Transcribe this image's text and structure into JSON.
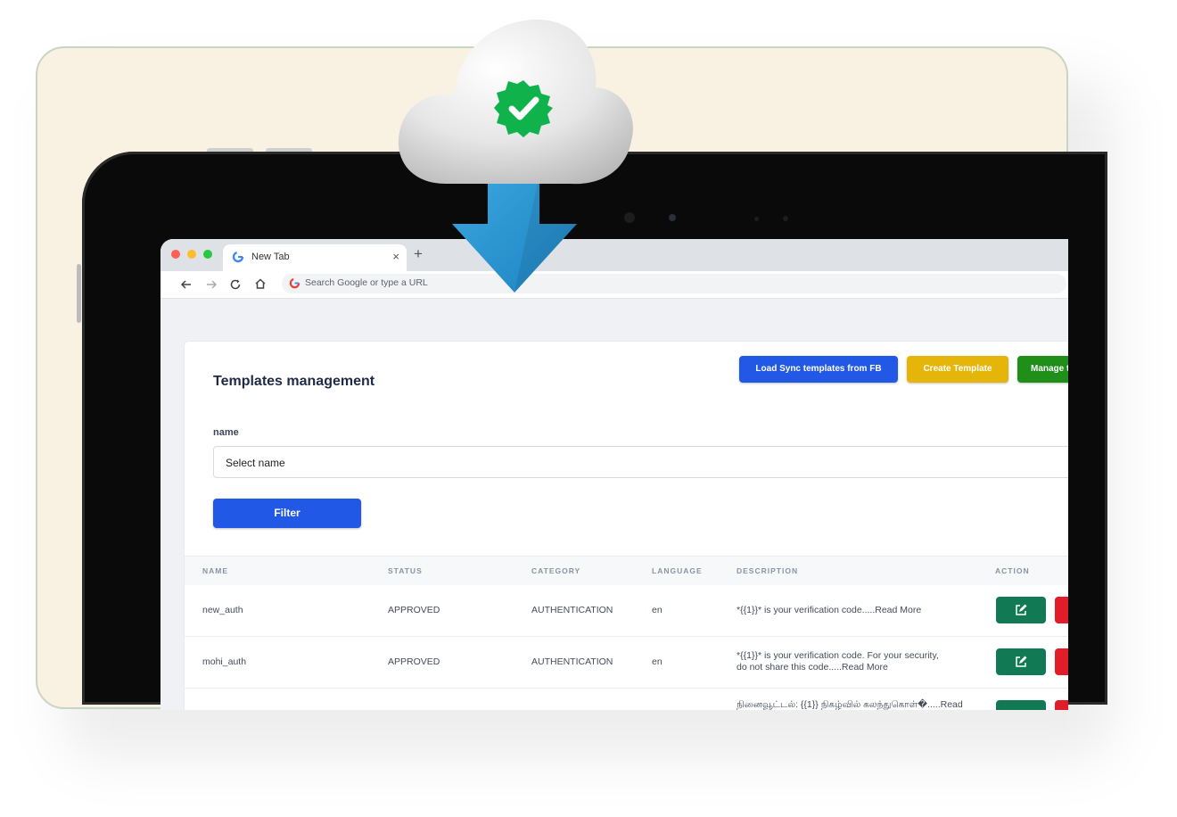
{
  "browser": {
    "tab_title": "New Tab",
    "tab_close": "×",
    "new_tab": "+",
    "omnibox_placeholder": "Search Google or type a URL"
  },
  "page": {
    "title": "Templates management",
    "buttons": {
      "load_sync": "Load Sync templates from FB",
      "create": "Create Template",
      "manage": "Manage t"
    },
    "filter": {
      "label": "name",
      "select_value": "Select name",
      "button": "Filter"
    },
    "table": {
      "headers": [
        "NAME",
        "STATUS",
        "CATEGORY",
        "LANGUAGE",
        "DESCRIPTION",
        "ACTION"
      ],
      "rows": [
        {
          "name": "new_auth",
          "status": "APPROVED",
          "category": "AUTHENTICATION",
          "language": "en",
          "description": "*{{1}}* is your verification code.....Read More"
        },
        {
          "name": "mohi_auth",
          "status": "APPROVED",
          "category": "AUTHENTICATION",
          "language": "en",
          "description": "*{{1}}* is your verification code. For your security, do not share this code.....Read More"
        },
        {
          "name": "",
          "status": "",
          "category": "",
          "language": "",
          "description": "நினைவூட்டல்: {{1}} நிகழ்வில் கலந்துகொள்�.....Read"
        }
      ]
    }
  },
  "colors": {
    "card_bg": "#f9f1e2",
    "card_border": "#c7d6c2",
    "load_sync_btn": "#2158e6",
    "create_btn": "#e5b50a",
    "manage_btn": "#1f8f1a",
    "filter_btn": "#2158e6",
    "edit_btn": "#117a55",
    "delete_btn": "#e11d2a",
    "arrow": "#2a95d0",
    "badge": "#10b24c"
  },
  "icons": {
    "cloud": "cloud-icon",
    "verified": "verified-badge-icon",
    "download": "download-arrow-icon",
    "edit": "edit-icon"
  }
}
